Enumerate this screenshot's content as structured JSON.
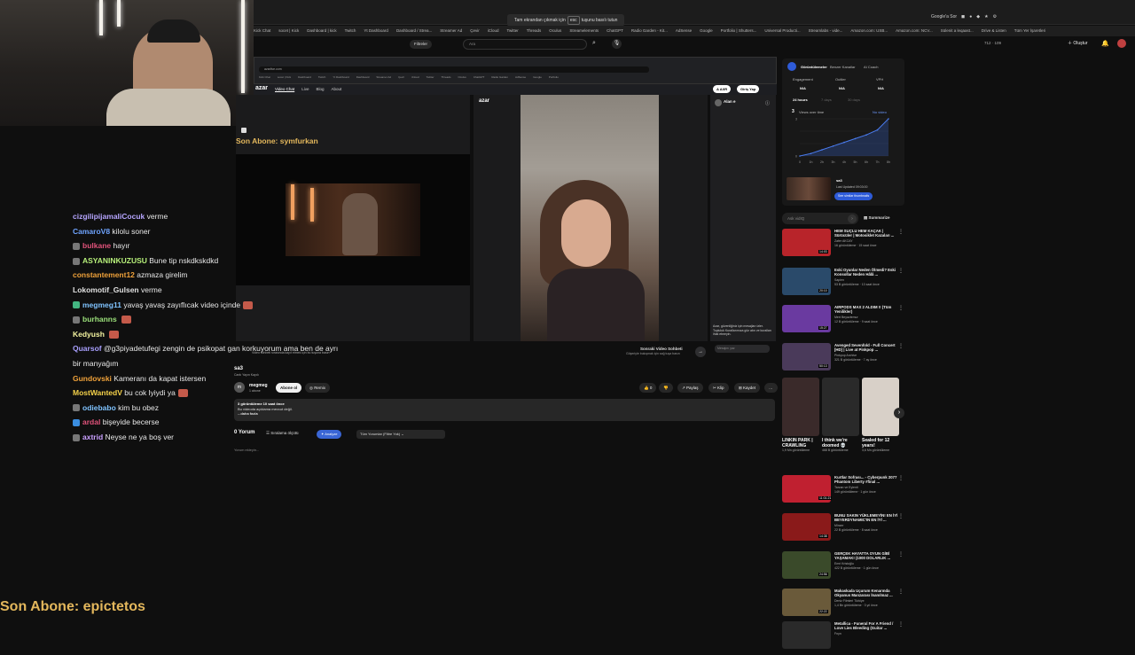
{
  "browser": {
    "esc_banner_pre": "Tam ekrandan çıkmak için",
    "esc_key": "esc",
    "esc_banner_post": "tuşunu basılı tutun",
    "right_icons": [
      "Google'a Sor"
    ],
    "bookmarks": [
      "Kick Chat",
      "socet | Kick",
      "Dashboard | kick",
      "Twitch",
      "Yt Dashboard",
      "Dashboard / Strea...",
      "Streamer Ad",
      "Çevir",
      "iCloud",
      "Twitter",
      "Threads",
      "Oculus",
      "Streamelements",
      "ChatGPT",
      "Radio Garden - Kit...",
      "AdSense",
      "Google",
      "Portfolio | Shutters...",
      "Universal Producti...",
      "Streamlabs - vide...",
      "Amazon.com: USB...",
      "Amazon.com: NCV...",
      "Sülenit a leqaast...",
      "Drive & Listen",
      "Tüm Yer İşaretleri"
    ]
  },
  "youtube_bar": {
    "filter": "Filtreler",
    "search_placeholder": "Ara",
    "create": "Oluştur",
    "nav_right": "712 · 109"
  },
  "overlay": {
    "last_sub_1": "Son Abone: symfurkan",
    "last_sub_2": "Son Abone: epictetos"
  },
  "chat": [
    {
      "user": "cizgilipijamaliCocuk",
      "color": "#b6a5ff",
      "text": "verme",
      "icon": ""
    },
    {
      "user": "CamaroV8",
      "color": "#6fa4ff",
      "text": "kilolu soner",
      "icon": ""
    },
    {
      "user": "bulkane",
      "color": "#e0527a",
      "text": "hayır",
      "icon": "#777"
    },
    {
      "user": "ASYANINKUZUSU",
      "color": "#b7f07a",
      "text": "Bune tip nskdkskdkd",
      "icon": "#777"
    },
    {
      "user": "constantement12",
      "color": "#f0a23a",
      "text": "azmaza girelim",
      "icon": ""
    },
    {
      "user": "Lokomotif_Gulsen",
      "color": "#e0e0e0",
      "text": "verme",
      "icon": ""
    },
    {
      "user": "megmeg11",
      "color": "#7fc3ff",
      "text": "yavaş yavaş zayıflıcak video içinde",
      "icon": "#43b581",
      "emote": true
    },
    {
      "user": "burhanns",
      "color": "#9be07a",
      "text": "",
      "icon": "#777",
      "emote": true
    },
    {
      "user": "Kedyush",
      "color": "#f3f3a0",
      "text": "",
      "icon": "",
      "emote": true
    },
    {
      "user": "Quarsof",
      "color": "#a9a0ff",
      "text": "@g3piyadetufegi zengin de psikopat gan korkuyorum ama ben de ayrı bir manyağım",
      "icon": "",
      "mention": true
    },
    {
      "user": "Gundovski",
      "color": "#f0a23a",
      "text": "Kameranı da kapat istersen",
      "icon": ""
    },
    {
      "user": "MostWantedV",
      "color": "#f5d24a",
      "text": "bu cok lyiydi ya",
      "icon": "",
      "emote": true
    },
    {
      "user": "odiebabo",
      "color": "#7fc3ff",
      "text": "kim bu obez",
      "icon": "#777"
    },
    {
      "user": "ardal",
      "color": "#e0527a",
      "text": "bişeyide becerse",
      "icon": "#3a8de0"
    },
    {
      "user": "axtrid",
      "color": "#c9a0ff",
      "text": "Neyse ne ya boş ver",
      "icon": "#777"
    }
  ],
  "azar": {
    "url": "azarlive.com",
    "bookmarks": [
      "Kick Chat",
      "socet | Kick",
      "Dashboard",
      "Twitch",
      "Yt Dashboard",
      "Dashboard",
      "Streamer Ad",
      "Çevir",
      "iCloud",
      "Twitter",
      "Threads",
      "Oculus",
      "ChatGPT",
      "Radio Garden",
      "AdSense",
      "Google",
      "Portfolio"
    ],
    "logo": "azar",
    "tabs": [
      "Video Chat",
      "Live",
      "Blog",
      "About"
    ],
    "btn_a": "A AXR",
    "btn_login": "Giriş Yap",
    "logo2": "azar",
    "partner_name": "Alan e",
    "chat_note": "Azar, güvenliğiniz için mesajları izler. Topluluk Kurallarımıza göz atın ve kuralları ihlal etmeyin.",
    "chat_placeholder": "Mesajını yaz",
    "next_title": "Sonraki Video Sohbeti",
    "next_sub": "Göşeriyle buluşmak için sağ tuşa basın",
    "caption": "Video sohbeti sırasında kayıt etmek için bu tuşuna basın"
  },
  "video": {
    "title": "sa3",
    "sub": "Canlı Yayın Kaydı",
    "channel_initial": "m",
    "channel": "megmeg",
    "subs": "1 abone",
    "subscribe": "Abone ol",
    "remix": "Remix",
    "likes": "0",
    "share": "Paylaş",
    "clip": "Klip",
    "save": "Kaydet",
    "desc_line1": "3 görüntüleme  10 saat önce",
    "desc_line2": "Bu videoda açıklama mevcut değil.",
    "desc_more": "...daha fazla",
    "comments": "0 Yorum",
    "sort": "Sıralama ölçütü",
    "analyze": "Analyze",
    "comment_filter": "Tüm Yorumlar (Filtre Yok)",
    "add_comment": "Yorum ekleyin..."
  },
  "analytics": {
    "tabs": [
      "Görüntülemeler",
      "Benzer Kanallar",
      "AI Coach"
    ],
    "metric_labels": [
      "Engagement",
      "Outlier",
      "VPH"
    ],
    "metric_values": [
      "N/A",
      "N/A",
      "N/A"
    ],
    "time_tabs": [
      "24 hours",
      "7 days",
      "30 days"
    ],
    "views_label": "Views over time",
    "views_value": "3",
    "no_video": "No video",
    "x_ticks": [
      "0",
      "1h",
      "2h",
      "3h",
      "4h",
      "5h",
      "6h",
      "7h",
      "8h"
    ],
    "sa3_title": "sa3",
    "sa3_sub": "Last Updated 09:03:00",
    "see_thumbs": "See similar thumbnails",
    "ask_placeholder": "Ask vidIQ",
    "summarize": "Summarize"
  },
  "chart_data": {
    "type": "line",
    "title": "Views over time",
    "x": [
      "0",
      "1h",
      "2h",
      "3h",
      "4h",
      "5h",
      "6h",
      "7h",
      "8h"
    ],
    "series": [
      {
        "name": "",
        "values": [
          0,
          0.2,
          0.5,
          0.8,
          1.1,
          1.4,
          1.7,
          2.1,
          3
        ]
      }
    ],
    "ylim": [
      0,
      3
    ]
  },
  "recommendations": [
    {
      "title": "HEM SUÇLU HEM KAÇAK | Sürücüler | Motosiklet Kazaları ...",
      "channel": "Zafer AKCAY",
      "meta": "16 görüntüleme · 15 saat önce",
      "duration": "14:03",
      "color": "#b8242a"
    },
    {
      "title": "Eski Oyunlar Neden Ölmedi? Eski Konsollar Neden Hâlâ ...",
      "channel": "Sapien",
      "meta": "53 B görüntüleme · 13 saat önce",
      "duration": "20:10",
      "color": "#2a4a6a"
    },
    {
      "title": "AIRPODS MAX 2 ALDIM !! (Tüm Yenilikler)",
      "channel": "Mert Beyaztemur",
      "meta": "12 B görüntüleme · 9 saat önce",
      "duration": "15:27",
      "color": "#6a3aa0"
    },
    {
      "title": "Avenged Sevenfold - Full Concert [HD] | Live at Pinkpop ...",
      "channel": "Pinkpop Archive",
      "meta": "321 B görüntüleme · 7 ay önce",
      "duration": "50:13",
      "color": "#4a3a5a"
    },
    {
      "title": "Kurtlar Sofrası... - Cyberpunk 2077 Phantom Liberty #final ...",
      "channel": "Tarzan ve Eylenti",
      "meta": "149 görüntüleme · 1 gün önce",
      "duration": "11:01:21",
      "color": "#c02030"
    },
    {
      "title": "BUNU SAKIN YÜKLEMEYİN! EN İYİ BEYERDYNAMIC'IN EN İYİ ...",
      "channel": "Minzer",
      "meta": "22 B görüntüleme · 8 saat önce",
      "duration": "14:38",
      "color": "#8a1a1a"
    },
    {
      "title": "GERÇEK HAYATTA OYUN GİBİ YAŞAMAK! (1000 DOLARLIK ...",
      "channel": "Emri Kristoğlu",
      "meta": "422 B görüntüleme · 1 gün önce",
      "duration": "24:56",
      "color": "#3a4a2a"
    },
    {
      "title": "Makaskada Uçurum Kenarında Okyanus Manzarası İnanılmaz ...",
      "channel": "Deniz Filmleri Türkiye",
      "meta": "1,4 Bn görüntüleme · 3 yıl önce",
      "duration": "22:22",
      "color": "#6a5a3a"
    },
    {
      "title": "Metallica - Funeral For A Friend / Love Lies Bleeding (Guitar ...",
      "channel": "Fnyn",
      "meta": "",
      "duration": "",
      "color": "#2a2a2a"
    }
  ],
  "shorts": [
    {
      "title": "LINKIN PARK | CRAWLING",
      "views": "1,9 Mn görüntüleme",
      "color": "#3a2a2a"
    },
    {
      "title": "I think we're doomed 💀",
      "views": "468 B görüntüleme",
      "color": "#2a2a2a"
    },
    {
      "title": "Sealed for 12 years!",
      "views": "3,6 Mn görüntüleme",
      "color": "#d8d0c8"
    }
  ]
}
